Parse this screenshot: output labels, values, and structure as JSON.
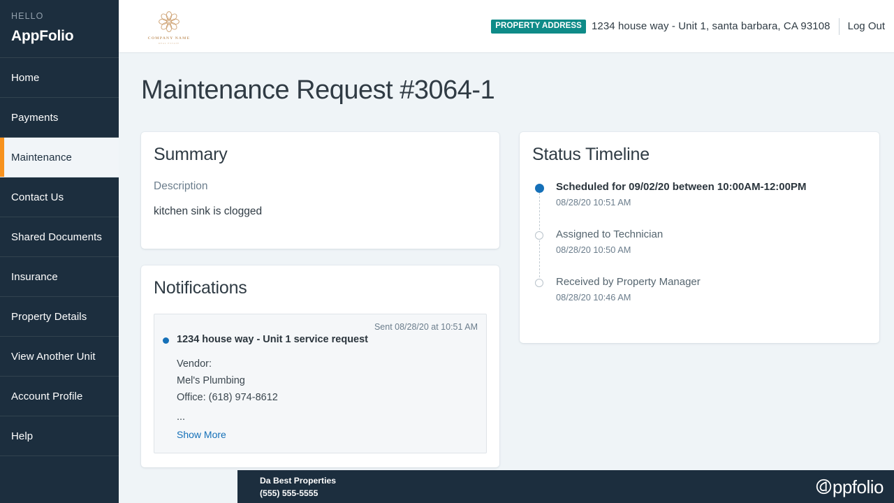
{
  "sidebar": {
    "greeting_label": "HELLO",
    "account_name": "AppFolio",
    "items": [
      {
        "label": "Home",
        "active": false
      },
      {
        "label": "Payments",
        "active": false
      },
      {
        "label": "Maintenance",
        "active": true
      },
      {
        "label": "Contact Us",
        "active": false
      },
      {
        "label": "Shared Documents",
        "active": false
      },
      {
        "label": "Insurance",
        "active": false
      },
      {
        "label": "Property Details",
        "active": false
      },
      {
        "label": "View Another Unit",
        "active": false
      },
      {
        "label": "Account Profile",
        "active": false
      },
      {
        "label": "Help",
        "active": false
      }
    ]
  },
  "topbar": {
    "logo_company_name": "COMPANY NAME",
    "logo_tagline": "REAL ESTATE",
    "address_badge_label": "PROPERTY ADDRESS",
    "address": "1234 house way - Unit 1, santa barbara, CA 93108",
    "logout_label": "Log Out"
  },
  "page": {
    "title": "Maintenance Request #3064-1"
  },
  "summary": {
    "title": "Summary",
    "description_label": "Description",
    "description_value": "kitchen sink is clogged"
  },
  "notifications": {
    "title": "Notifications",
    "items": [
      {
        "sent_label": "Sent 08/28/20 at 10:51 AM",
        "headline": "1234 house way - Unit 1 service request",
        "body_lines": [
          "Vendor:",
          "Mel's Plumbing",
          "Office: (618) 974-8612"
        ],
        "ellipsis": "...",
        "show_more_label": "Show More"
      }
    ]
  },
  "status_timeline": {
    "title": "Status Timeline",
    "entries": [
      {
        "label": "Scheduled for 09/02/20 between 10:00AM-12:00PM",
        "timestamp": "08/28/20 10:51 AM",
        "state": "current"
      },
      {
        "label": "Assigned to Technician",
        "timestamp": "08/28/20 10:50 AM",
        "state": "past"
      },
      {
        "label": "Received by Property Manager",
        "timestamp": "08/28/20 10:46 AM",
        "state": "past"
      }
    ]
  },
  "footer": {
    "company": "Da Best Properties",
    "phone": "(555) 555-5555",
    "brand": "ppfolio"
  },
  "colors": {
    "sidebar_bg": "#1c2e3e",
    "accent_orange": "#f7921e",
    "badge_teal": "#0e8b88",
    "link_blue": "#1570b8",
    "page_bg": "#eff4f7",
    "logo_gold": "#c59a6b"
  }
}
